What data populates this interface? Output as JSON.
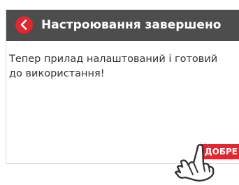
{
  "header": {
    "title": "Настроювання завершено",
    "back_icon": "chevron-left-icon"
  },
  "message": "Тепер прилад налаштований і готовий до використання!",
  "ok_button": {
    "label": "ДОБРЕ"
  },
  "pointer": {
    "icon": "hand-tap-icon"
  },
  "colors": {
    "header_bg": "#4d4d4d",
    "accent": "#e3262f",
    "text": "#333333"
  }
}
